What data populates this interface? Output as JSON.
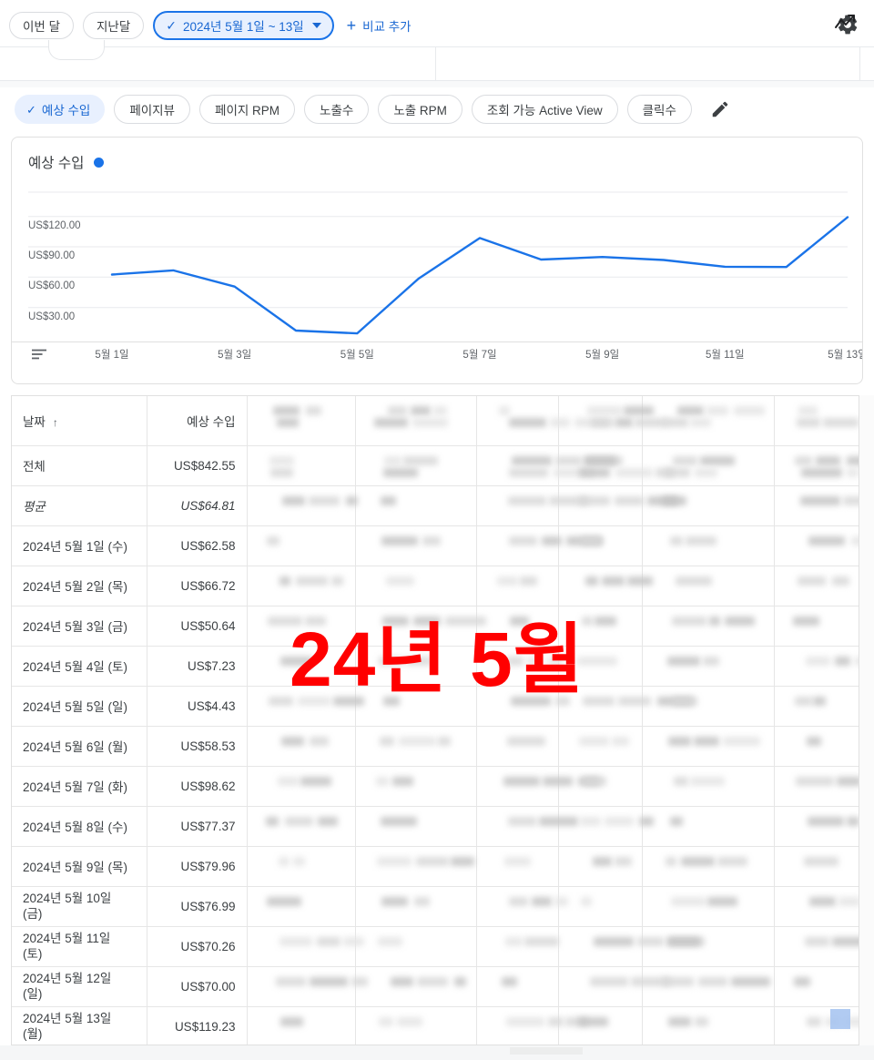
{
  "topbar": {
    "this_month": "이번 달",
    "last_month": "지난달",
    "date_range": "2024년 5월 1일 ~ 13일",
    "check_glyph": "✓",
    "add_compare": "비교 추가",
    "plus_glyph": "+",
    "settings_icon": "gear-icon"
  },
  "metrics": {
    "tabs": [
      {
        "label": "예상 수입",
        "active": true
      },
      {
        "label": "페이지뷰",
        "active": false
      },
      {
        "label": "페이지 RPM",
        "active": false
      },
      {
        "label": "노출수",
        "active": false
      },
      {
        "label": "노출 RPM",
        "active": false
      },
      {
        "label": "조회 가능 Active View",
        "active": false
      },
      {
        "label": "클릭수",
        "active": false
      }
    ],
    "check_glyph": "✓",
    "edit_icon": "pencil-icon",
    "trend_icon": "trend-line-icon"
  },
  "chart_data": {
    "type": "line",
    "title": "예상 수입",
    "legend": [
      "예상 수입"
    ],
    "legend_position": "inline-title",
    "series_color": "#1a73e8",
    "grid": true,
    "xlabel": "",
    "ylabel": "",
    "ylim": [
      0,
      135
    ],
    "yticks": [
      30,
      60,
      90,
      120
    ],
    "ytick_labels": [
      "US$30.00",
      "US$60.00",
      "US$90.00",
      "US$120.00"
    ],
    "x": [
      "2024년 5월 1일",
      "2024년 5월 2일",
      "2024년 5월 3일",
      "2024년 5월 4일",
      "2024년 5월 5일",
      "2024년 5월 6일",
      "2024년 5월 7일",
      "2024년 5월 8일",
      "2024년 5월 9일",
      "2024년 5월 10일",
      "2024년 5월 11일",
      "2024년 5월 12일",
      "2024년 5월 13일"
    ],
    "xtick_labels": [
      "5월 1일",
      "5월 3일",
      "5월 5일",
      "5월 7일",
      "5월 9일",
      "5월 11일",
      "5월 13일"
    ],
    "values": [
      62.58,
      66.72,
      50.64,
      7.23,
      4.43,
      58.53,
      98.62,
      77.37,
      79.96,
      76.99,
      70.26,
      70.0,
      119.23
    ],
    "currency": "USD"
  },
  "table": {
    "headers": {
      "date": "날짜",
      "sort_glyph": "↑",
      "value": "예상 수입"
    },
    "summary": [
      {
        "label": "전체",
        "value": "US$842.55",
        "kind": "total"
      },
      {
        "label": "평균",
        "value": "US$64.81",
        "kind": "average"
      }
    ],
    "rows": [
      {
        "date": "2024년 5월 1일 (수)",
        "value": "US$62.58"
      },
      {
        "date": "2024년 5월 2일 (목)",
        "value": "US$66.72"
      },
      {
        "date": "2024년 5월 3일 (금)",
        "value": "US$50.64"
      },
      {
        "date": "2024년 5월 4일 (토)",
        "value": "US$7.23"
      },
      {
        "date": "2024년 5월 5일 (일)",
        "value": "US$4.43"
      },
      {
        "date": "2024년 5월 6일 (월)",
        "value": "US$58.53"
      },
      {
        "date": "2024년 5월 7일 (화)",
        "value": "US$98.62"
      },
      {
        "date": "2024년 5월 8일 (수)",
        "value": "US$77.37"
      },
      {
        "date": "2024년 5월 9일 (목)",
        "value": "US$79.96"
      },
      {
        "date": "2024년 5월 10일 (금)",
        "value": "US$76.99"
      },
      {
        "date": "2024년 5월 11일 (토)",
        "value": "US$70.26"
      },
      {
        "date": "2024년 5월 12일 (일)",
        "value": "US$70.00"
      },
      {
        "date": "2024년 5월 13일 (월)",
        "value": "US$119.23"
      }
    ],
    "redacted_columns": 6
  },
  "overlay": {
    "stamp_text": "24년 5월",
    "stamp_color": "#ff0000"
  },
  "colors": {
    "accent": "#1a73e8",
    "accent_chip_bg": "#e8f0fe",
    "accent_chip_text": "#1967d2",
    "border": "#dadce0",
    "text": "#3c4043",
    "muted_text": "#5f6368"
  }
}
